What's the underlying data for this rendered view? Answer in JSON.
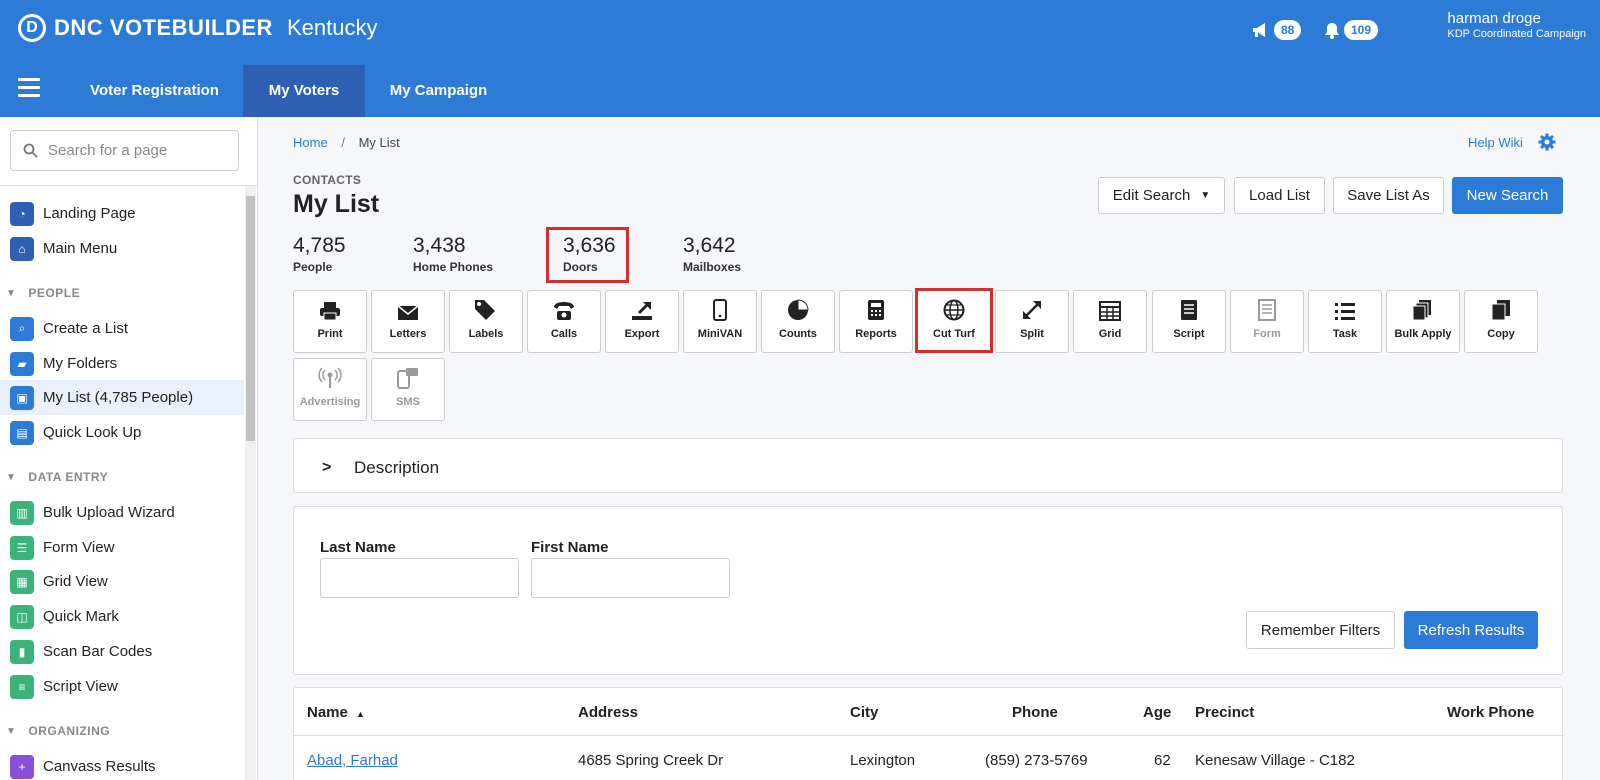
{
  "header": {
    "brand_logo_letter": "D",
    "brand_name": "DNC VOTEBUILDER",
    "state": "Kentucky",
    "announcements_count": "88",
    "notifications_count": "109",
    "user_name": "harman droge",
    "user_org": "KDP Coordinated Campaign"
  },
  "nav": {
    "tabs": [
      {
        "label": "Voter Registration"
      },
      {
        "label": "My Voters"
      },
      {
        "label": "My Campaign"
      }
    ],
    "active_tab": "My Voters"
  },
  "sidebar": {
    "search_placeholder": "Search for a page",
    "items": [
      {
        "label": "Landing Page"
      },
      {
        "label": "Main Menu"
      },
      {
        "label": "Create a List"
      },
      {
        "label": "My Folders"
      },
      {
        "label": "My List (4,785 People)"
      },
      {
        "label": "Quick Look Up"
      },
      {
        "label": "Bulk Upload Wizard"
      },
      {
        "label": "Form View"
      },
      {
        "label": "Grid View"
      },
      {
        "label": "Quick Mark"
      },
      {
        "label": "Scan Bar Codes"
      },
      {
        "label": "Script View"
      },
      {
        "label": "Canvass Results"
      }
    ],
    "sections": [
      "PEOPLE",
      "DATA ENTRY",
      "ORGANIZING"
    ]
  },
  "breadcrumb": {
    "home": "Home",
    "separator": "/",
    "current": "My List"
  },
  "help_wiki": "Help Wiki",
  "page": {
    "section_label": "CONTACTS",
    "title": "My List"
  },
  "actions": {
    "edit_search": "Edit Search",
    "load_list": "Load List",
    "save_list_as": "Save List As",
    "new_search": "New Search"
  },
  "stats": [
    {
      "value": "4,785",
      "label": "People"
    },
    {
      "value": "3,438",
      "label": "Home Phones"
    },
    {
      "value": "3,636",
      "label": "Doors"
    },
    {
      "value": "3,642",
      "label": "Mailboxes"
    }
  ],
  "tools": [
    {
      "label": "Print",
      "icon": "printer-icon"
    },
    {
      "label": "Letters",
      "icon": "envelope-icon"
    },
    {
      "label": "Labels",
      "icon": "tags-icon"
    },
    {
      "label": "Calls",
      "icon": "phone-icon"
    },
    {
      "label": "Export",
      "icon": "export-icon"
    },
    {
      "label": "MiniVAN",
      "icon": "mobile-icon"
    },
    {
      "label": "Counts",
      "icon": "pie-chart-icon"
    },
    {
      "label": "Reports",
      "icon": "calculator-icon"
    },
    {
      "label": "Cut Turf",
      "icon": "globe-icon"
    },
    {
      "label": "Split",
      "icon": "expand-icon"
    },
    {
      "label": "Grid",
      "icon": "grid-icon"
    },
    {
      "label": "Script",
      "icon": "script-icon"
    },
    {
      "label": "Form",
      "icon": "form-icon"
    },
    {
      "label": "Task",
      "icon": "list-icon"
    },
    {
      "label": "Bulk Apply",
      "icon": "bulk-apply-icon"
    },
    {
      "label": "Copy",
      "icon": "copy-icon"
    },
    {
      "label": "Advertising",
      "icon": "broadcast-icon"
    },
    {
      "label": "SMS",
      "icon": "sms-icon"
    }
  ],
  "description": {
    "title": "Description"
  },
  "filters": {
    "last_name_label": "Last Name",
    "last_name_value": "",
    "first_name_label": "First Name",
    "first_name_value": "",
    "remember_filters": "Remember Filters",
    "refresh_results": "Refresh Results"
  },
  "table": {
    "columns": [
      "Name",
      "Address",
      "City",
      "Phone",
      "Age",
      "Precinct",
      "Work Phone"
    ],
    "sort_indicator": "▲",
    "rows": [
      {
        "name": "Abad, Farhad",
        "address": "4685 Spring Creek Dr",
        "city": "Lexington",
        "phone": "(859) 273-5769",
        "age": "62",
        "precinct": "Kenesaw Village - C182",
        "work_phone": ""
      }
    ]
  },
  "colors": {
    "brand_blue": "#2c7bd6",
    "active_tab": "#2f5fb3",
    "highlight": "#d32f2f"
  }
}
